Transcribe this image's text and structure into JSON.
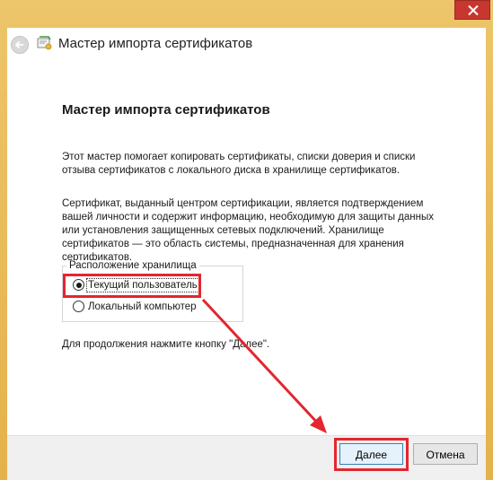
{
  "window": {
    "title": "Мастер импорта сертификатов",
    "close_icon": "close-icon",
    "back_icon": "back-arrow-icon",
    "app_icon": "certificate-icon"
  },
  "wizard": {
    "heading": "Мастер импорта сертификатов",
    "paragraph1": "Этот мастер помогает копировать сертификаты, списки доверия и списки отзыва сертификатов с локального диска в хранилище сертификатов.",
    "paragraph2": "Сертификат, выданный центром сертификации, является подтверждением вашей личности и содержит информацию, необходимую для защиты данных или установления защищенных сетевых подключений. Хранилище сертификатов — это область системы, предназначенная для хранения сертификатов.",
    "store_location": {
      "legend": "Расположение хранилища",
      "options": [
        {
          "label": "Текущий пользователь",
          "checked": true
        },
        {
          "label": "Локальный компьютер",
          "checked": false
        }
      ]
    },
    "hint": "Для продолжения нажмите кнопку \"Далее\"."
  },
  "footer": {
    "next_label": "Далее",
    "cancel_label": "Отмена"
  },
  "colors": {
    "title_bar": "#e7b64f",
    "close_button": "#c7372f",
    "annotation": "#e3262f"
  }
}
